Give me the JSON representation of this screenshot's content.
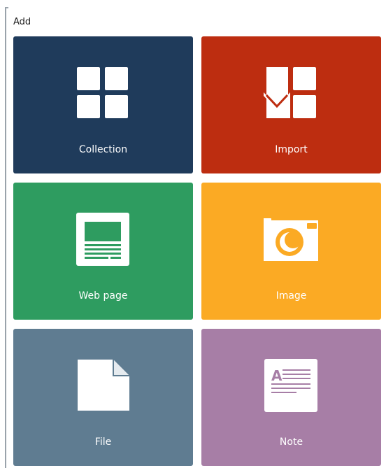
{
  "heading": "Add",
  "tiles": [
    {
      "label": "Collection",
      "icon": "collection-grid-icon",
      "color": "#1f3b5b"
    },
    {
      "label": "Import",
      "icon": "import-icon",
      "color": "#bd2d10"
    },
    {
      "label": "Web page",
      "icon": "webpage-icon",
      "color": "#2e9c60"
    },
    {
      "label": "Image",
      "icon": "camera-icon",
      "color": "#fbaa24"
    },
    {
      "label": "File",
      "icon": "file-icon",
      "color": "#5f7c91"
    },
    {
      "label": "Note",
      "icon": "note-icon",
      "color": "#a77ea6"
    }
  ]
}
